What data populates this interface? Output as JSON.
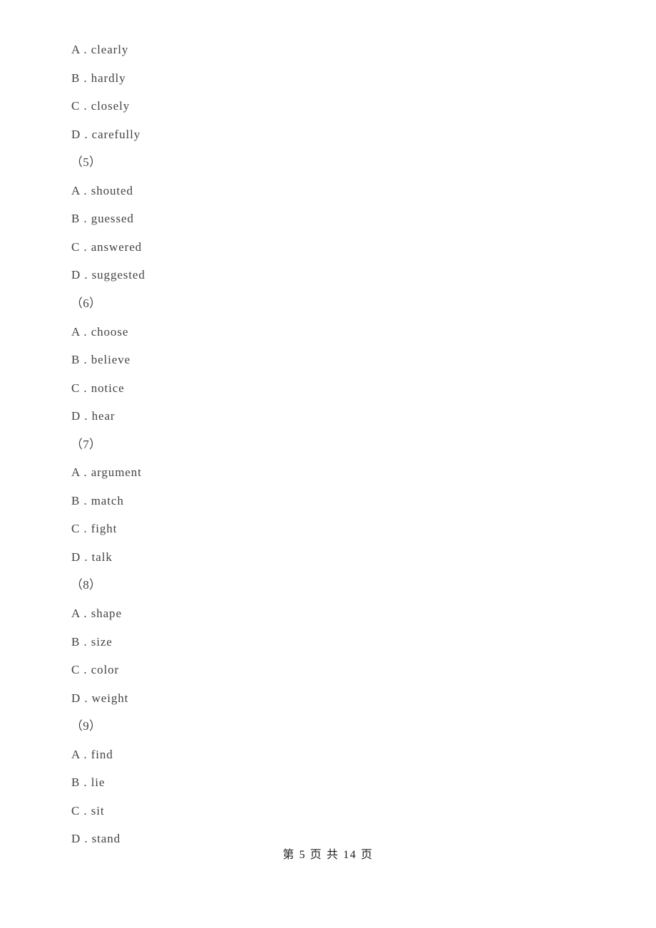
{
  "document": {
    "page_background": "#ffffff",
    "text_color": "#434343",
    "footer_color": "#1c1c1c"
  },
  "body_lines": [
    {
      "kind": "option",
      "text": "A . clearly"
    },
    {
      "kind": "option",
      "text": "B . hardly"
    },
    {
      "kind": "option",
      "text": "C . closely"
    },
    {
      "kind": "option",
      "text": "D . carefully"
    },
    {
      "kind": "qnum",
      "text": "（5）"
    },
    {
      "kind": "option",
      "text": "A . shouted"
    },
    {
      "kind": "option",
      "text": "B . guessed"
    },
    {
      "kind": "option",
      "text": "C . answered"
    },
    {
      "kind": "option",
      "text": "D . suggested"
    },
    {
      "kind": "qnum",
      "text": "（6）"
    },
    {
      "kind": "option",
      "text": "A . choose"
    },
    {
      "kind": "option",
      "text": "B . believe"
    },
    {
      "kind": "option",
      "text": "C . notice"
    },
    {
      "kind": "option",
      "text": "D . hear"
    },
    {
      "kind": "qnum",
      "text": "（7）"
    },
    {
      "kind": "option",
      "text": "A . argument"
    },
    {
      "kind": "option",
      "text": "B . match"
    },
    {
      "kind": "option",
      "text": "C . fight"
    },
    {
      "kind": "option",
      "text": "D . talk"
    },
    {
      "kind": "qnum",
      "text": "（8）"
    },
    {
      "kind": "option",
      "text": "A . shape"
    },
    {
      "kind": "option",
      "text": "B . size"
    },
    {
      "kind": "option",
      "text": "C . color"
    },
    {
      "kind": "option",
      "text": "D . weight"
    },
    {
      "kind": "qnum",
      "text": "（9）"
    },
    {
      "kind": "option",
      "text": "A . find"
    },
    {
      "kind": "option",
      "text": "B . lie"
    },
    {
      "kind": "option",
      "text": "C . sit"
    },
    {
      "kind": "option",
      "text": "D . stand"
    }
  ],
  "questions": [
    {
      "number": "（5）",
      "options": [
        {
          "label": "A",
          "text": "shouted"
        },
        {
          "label": "B",
          "text": "guessed"
        },
        {
          "label": "C",
          "text": "answered"
        },
        {
          "label": "D",
          "text": "suggested"
        }
      ]
    },
    {
      "number": "（6）",
      "options": [
        {
          "label": "A",
          "text": "choose"
        },
        {
          "label": "B",
          "text": "believe"
        },
        {
          "label": "C",
          "text": "notice"
        },
        {
          "label": "D",
          "text": "hear"
        }
      ]
    },
    {
      "number": "（7）",
      "options": [
        {
          "label": "A",
          "text": "argument"
        },
        {
          "label": "B",
          "text": "match"
        },
        {
          "label": "C",
          "text": "fight"
        },
        {
          "label": "D",
          "text": "talk"
        }
      ]
    },
    {
      "number": "（8）",
      "options": [
        {
          "label": "A",
          "text": "shape"
        },
        {
          "label": "B",
          "text": "size"
        },
        {
          "label": "C",
          "text": "color"
        },
        {
          "label": "D",
          "text": "weight"
        }
      ]
    },
    {
      "number": "（9）",
      "options": [
        {
          "label": "A",
          "text": "find"
        },
        {
          "label": "B",
          "text": "lie"
        },
        {
          "label": "C",
          "text": "sit"
        },
        {
          "label": "D",
          "text": "stand"
        }
      ]
    }
  ],
  "continued_options_from_previous_question": [
    {
      "label": "A",
      "text": "clearly"
    },
    {
      "label": "B",
      "text": "hardly"
    },
    {
      "label": "C",
      "text": "closely"
    },
    {
      "label": "D",
      "text": "carefully"
    }
  ],
  "footer": {
    "text": "第 5 页 共 14 页",
    "current_page": "5",
    "total_pages": "14"
  }
}
